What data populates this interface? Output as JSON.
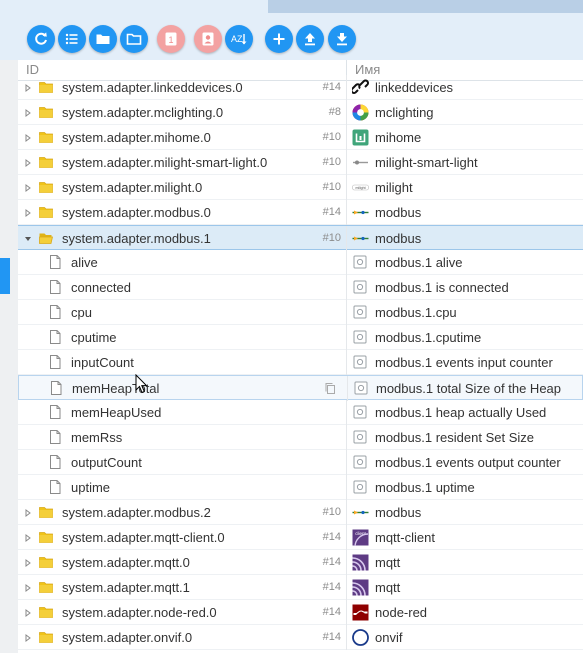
{
  "toolbar": {
    "buttons": [
      {
        "id": "refresh",
        "icon": "refresh-icon"
      },
      {
        "id": "list",
        "icon": "list-icon"
      },
      {
        "id": "folder",
        "icon": "folder-icon"
      },
      {
        "id": "folder-open",
        "icon": "folder-open-icon"
      },
      {
        "id": "count",
        "icon": "number-icon",
        "label": "1"
      },
      {
        "id": "user",
        "icon": "user-icon"
      },
      {
        "id": "sort",
        "icon": "sort-az-icon",
        "label": "AZ"
      },
      {
        "id": "add",
        "icon": "plus-icon"
      },
      {
        "id": "upload",
        "icon": "upload-icon"
      },
      {
        "id": "download",
        "icon": "download-icon"
      }
    ],
    "colors": {
      "primary": "#2196f3",
      "pink": "#f3a2a2",
      "bar": "#e3eef9"
    }
  },
  "table": {
    "columns": {
      "id": "ID",
      "name": "Имя"
    },
    "rows": [
      {
        "id": "system.adapter.linkeddevices.0",
        "badge": "#14",
        "name": "linkeddevices",
        "type": "folder",
        "icon": "link-icon"
      },
      {
        "id": "system.adapter.mclighting.0",
        "badge": "#8",
        "name": "mclighting",
        "type": "folder",
        "icon": "color-wheel-icon"
      },
      {
        "id": "system.adapter.mihome.0",
        "badge": "#10",
        "name": "mihome",
        "type": "folder",
        "icon": "mihome-icon"
      },
      {
        "id": "system.adapter.milight-smart-light.0",
        "badge": "#10",
        "name": "milight-smart-light",
        "type": "folder",
        "icon": "bulb-icon"
      },
      {
        "id": "system.adapter.milight.0",
        "badge": "#10",
        "name": "milight",
        "type": "folder",
        "icon": "milight-logo-icon"
      },
      {
        "id": "system.adapter.modbus.0",
        "badge": "#14",
        "name": "modbus",
        "type": "folder",
        "icon": "modbus-icon"
      },
      {
        "id": "system.adapter.modbus.1",
        "badge": "#10",
        "name": "modbus",
        "type": "folder-open",
        "icon": "modbus-icon",
        "selected": true
      },
      {
        "id": "alive",
        "name": "modbus.1 alive",
        "type": "state",
        "icon": "state-icon"
      },
      {
        "id": "connected",
        "name": "modbus.1 is connected",
        "type": "state",
        "icon": "state-icon"
      },
      {
        "id": "cpu",
        "name": "modbus.1.cpu",
        "type": "state",
        "icon": "state-icon"
      },
      {
        "id": "cputime",
        "name": "modbus.1.cputime",
        "type": "state",
        "icon": "state-icon"
      },
      {
        "id": "inputCount",
        "name": "modbus.1 events input counter",
        "type": "state",
        "icon": "state-icon"
      },
      {
        "id": "memHeapTotal",
        "name": "modbus.1 total Size of the Heap",
        "type": "state",
        "icon": "state-icon",
        "hovered": true
      },
      {
        "id": "memHeapUsed",
        "name": "modbus.1 heap actually Used",
        "type": "state",
        "icon": "state-icon"
      },
      {
        "id": "memRss",
        "name": "modbus.1 resident Set Size",
        "type": "state",
        "icon": "state-icon"
      },
      {
        "id": "outputCount",
        "name": "modbus.1 events output counter",
        "type": "state",
        "icon": "state-icon"
      },
      {
        "id": "uptime",
        "name": "modbus.1 uptime",
        "type": "state",
        "icon": "state-icon"
      },
      {
        "id": "system.adapter.modbus.2",
        "badge": "#10",
        "name": "modbus",
        "type": "folder",
        "icon": "modbus-icon"
      },
      {
        "id": "system.adapter.mqtt-client.0",
        "badge": "#14",
        "name": "mqtt-client",
        "type": "folder",
        "icon": "mqtt-client-icon"
      },
      {
        "id": "system.adapter.mqtt.0",
        "badge": "#14",
        "name": "mqtt",
        "type": "folder",
        "icon": "mqtt-icon"
      },
      {
        "id": "system.adapter.mqtt.1",
        "badge": "#14",
        "name": "mqtt",
        "type": "folder",
        "icon": "mqtt-icon"
      },
      {
        "id": "system.adapter.node-red.0",
        "badge": "#14",
        "name": "node-red",
        "type": "folder",
        "icon": "node-red-icon"
      },
      {
        "id": "system.adapter.onvif.0",
        "badge": "#14",
        "name": "onvif",
        "type": "folder",
        "icon": "onvif-icon"
      }
    ]
  }
}
